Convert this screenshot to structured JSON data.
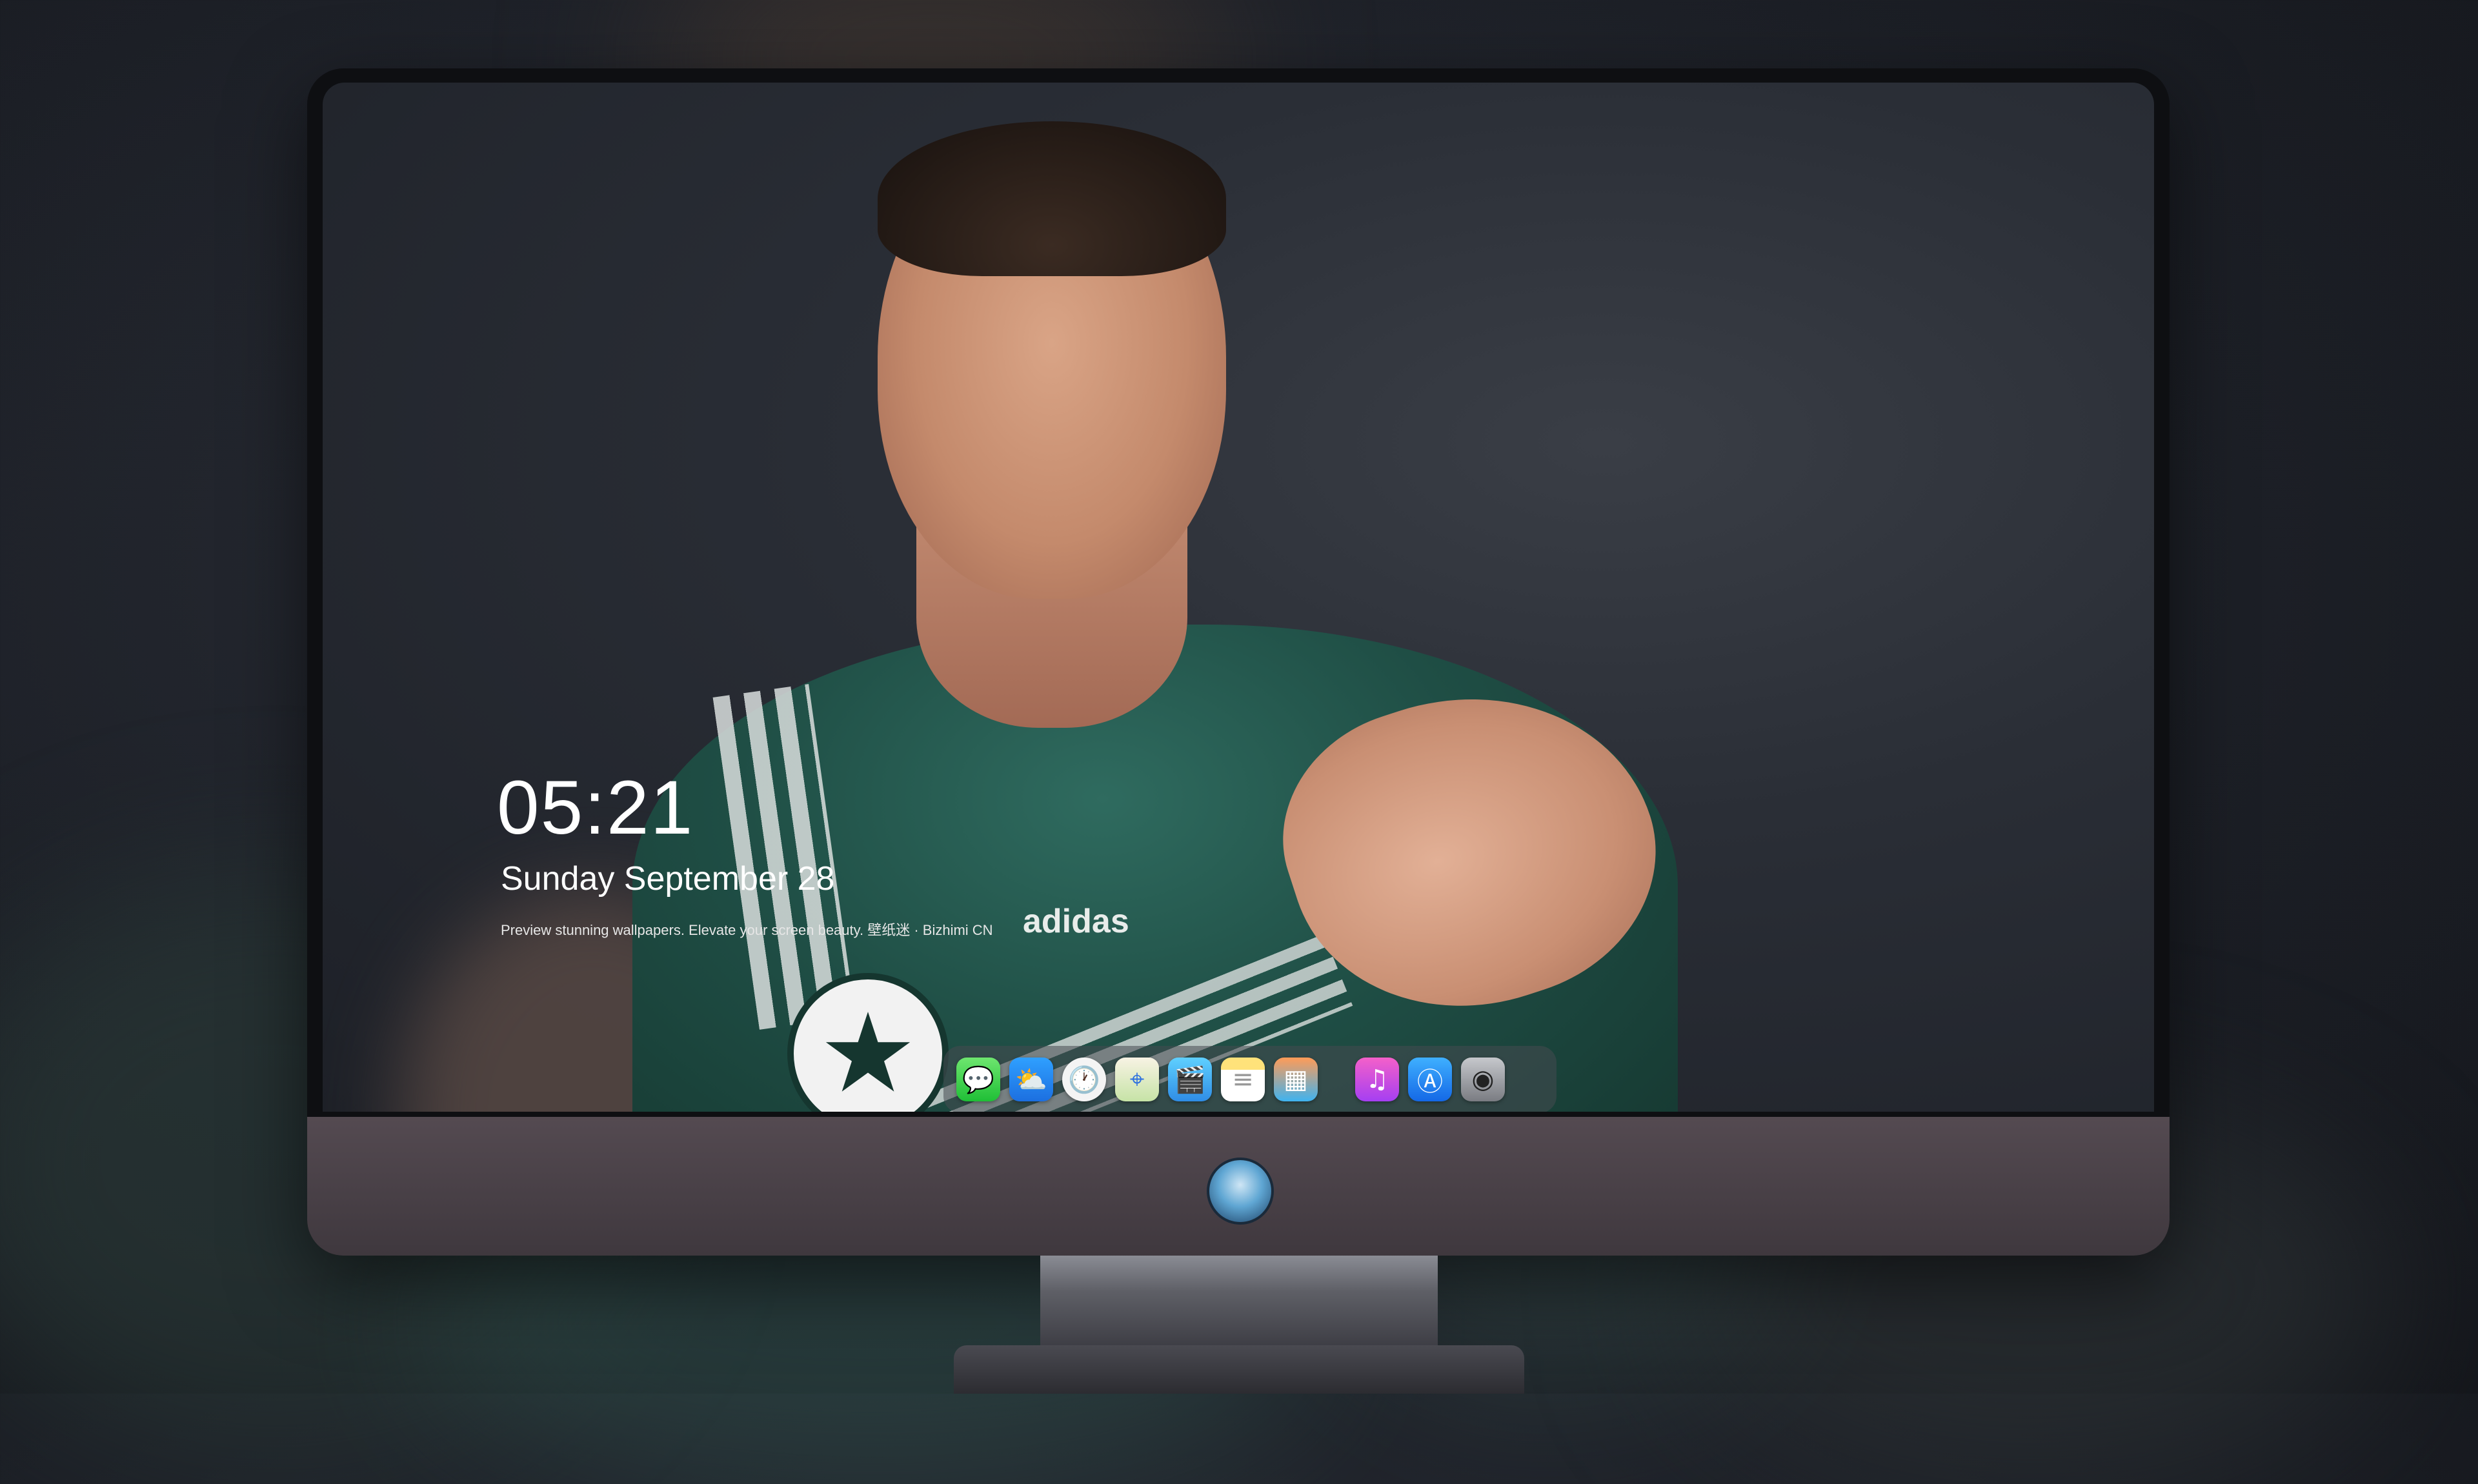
{
  "lockscreen": {
    "time": "05:21",
    "date": "Sunday September 28",
    "tagline": "Preview stunning wallpapers. Elevate your screen beauty. 壁纸迷 · Bizhimi CN"
  },
  "dock": {
    "apps": [
      {
        "name": "messages",
        "icon": "💬"
      },
      {
        "name": "weather",
        "icon": "⛅"
      },
      {
        "name": "clock",
        "icon": "🕐"
      },
      {
        "name": "maps",
        "icon": "⌖"
      },
      {
        "name": "videos",
        "icon": "🎬"
      },
      {
        "name": "notes",
        "icon": "≡"
      },
      {
        "name": "photos",
        "icon": "▦"
      },
      {
        "name": "music",
        "icon": "♫"
      },
      {
        "name": "app-store",
        "icon": "Ⓐ"
      },
      {
        "name": "camera",
        "icon": "◉"
      }
    ]
  },
  "wallpaper": {
    "jersey_brand": "adidas"
  }
}
